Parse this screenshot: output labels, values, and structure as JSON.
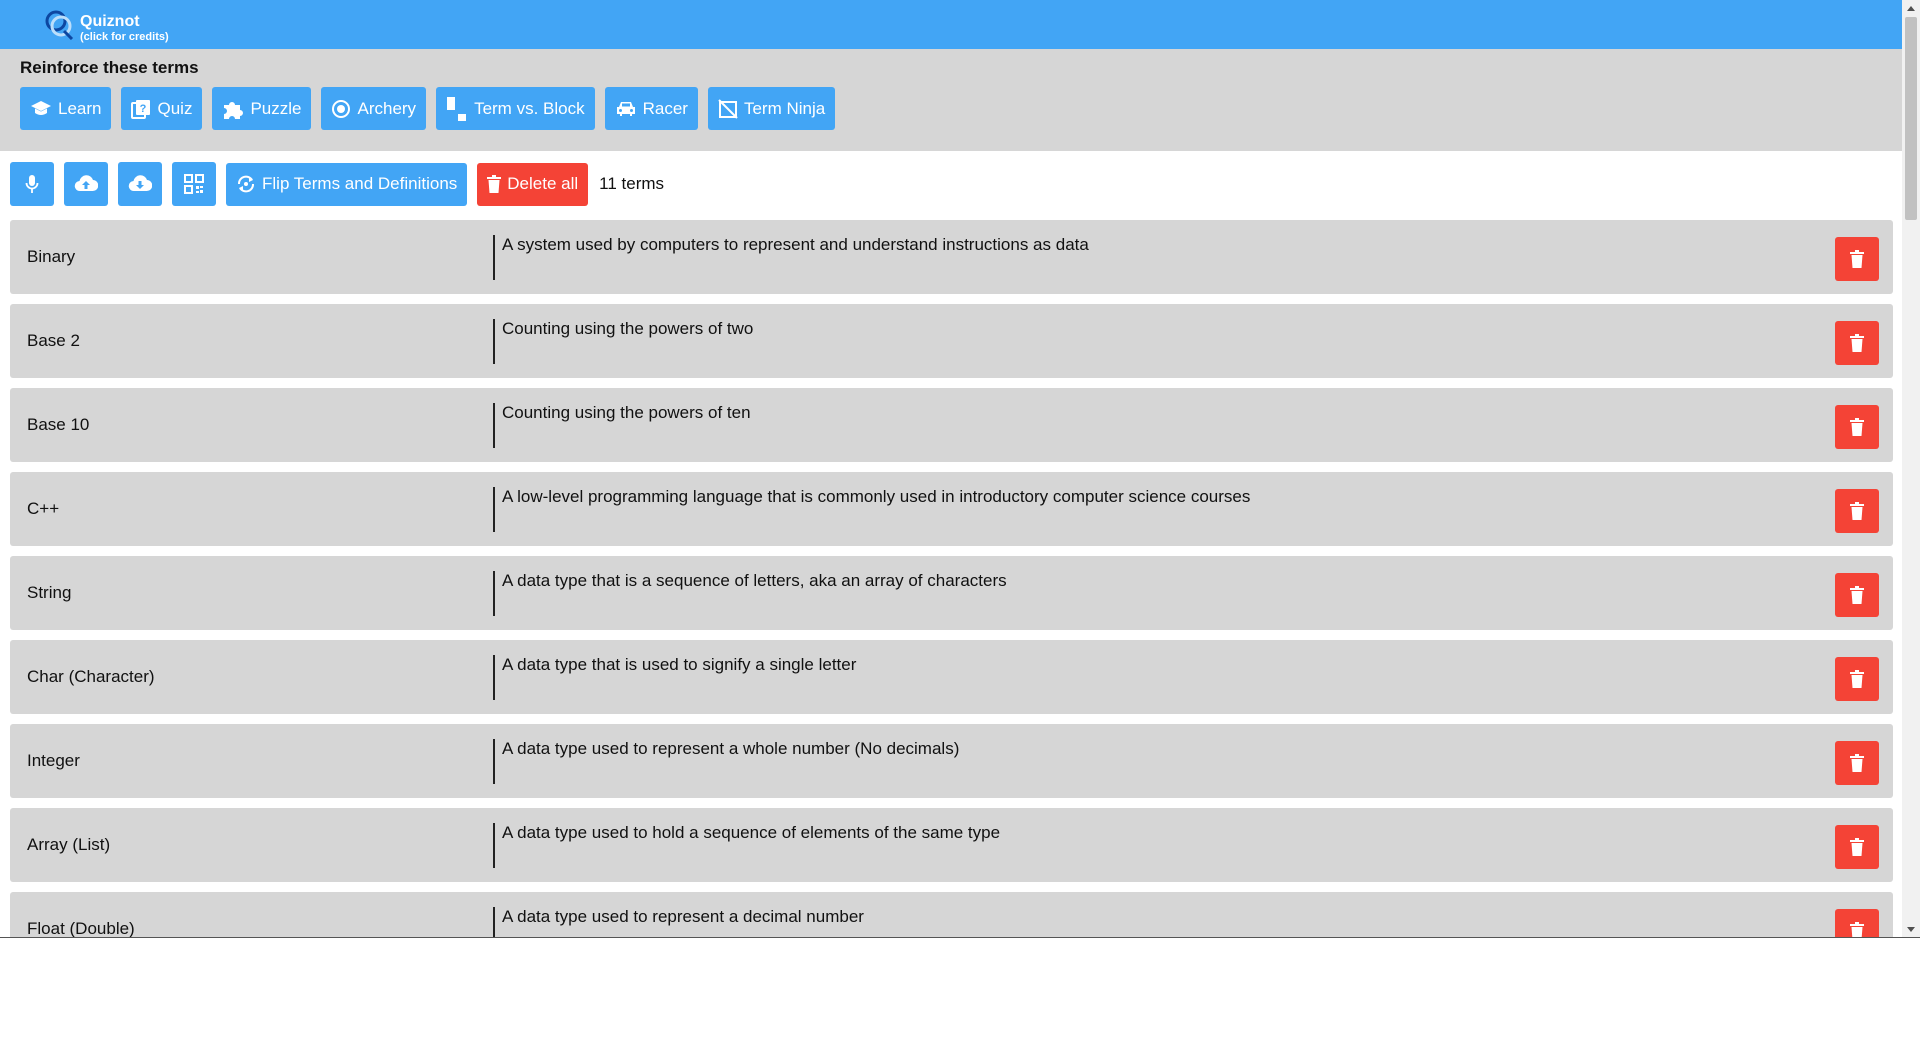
{
  "header": {
    "app_name": "Quiznot",
    "credits_hint": "(click for credits)",
    "logo_icon": "quiznot-logo-icon"
  },
  "games": {
    "title": "Reinforce these terms",
    "buttons": [
      {
        "label": "Learn",
        "icon": "graduation-cap-icon"
      },
      {
        "label": "Quiz",
        "icon": "question-book-icon"
      },
      {
        "label": "Puzzle",
        "icon": "puzzle-piece-icon"
      },
      {
        "label": "Archery",
        "icon": "target-icon"
      },
      {
        "label": "Term vs. Block",
        "icon": "block-icon"
      },
      {
        "label": "Racer",
        "icon": "car-icon"
      },
      {
        "label": "Term Ninja",
        "icon": "crossed-square-icon"
      }
    ]
  },
  "toolbar": {
    "mic_icon": "microphone-icon",
    "upload_icon": "cloud-upload-icon",
    "download_icon": "cloud-download-icon",
    "qr_icon": "qr-code-icon",
    "flip_label": "Flip Terms and Definitions",
    "delete_all_label": "Delete all",
    "terms_count": "11 terms"
  },
  "terms": [
    {
      "term": "Binary",
      "definition": "A system used by computers to represent and understand instructions as data"
    },
    {
      "term": "Base 2",
      "definition": "Counting using the powers of two"
    },
    {
      "term": "Base 10",
      "definition": "Counting using the powers of ten"
    },
    {
      "term": "C++",
      "definition": "A low-level programming language that is commonly used in introductory computer science courses"
    },
    {
      "term": "String",
      "definition": "A data type that is a sequence of letters, aka an array of characters"
    },
    {
      "term": "Char (Character)",
      "definition": "A data type that is used to signify a single letter"
    },
    {
      "term": "Integer",
      "definition": "A data type used to represent a whole number (No decimals)"
    },
    {
      "term": "Array (List)",
      "definition": "A data type used to hold a sequence of elements of the same type"
    },
    {
      "term": "Float (Double)",
      "definition": "A data type used to represent a decimal number"
    }
  ],
  "colors": {
    "primary": "#42a5f5",
    "danger": "#f44336",
    "panel": "#d6d6d6"
  }
}
